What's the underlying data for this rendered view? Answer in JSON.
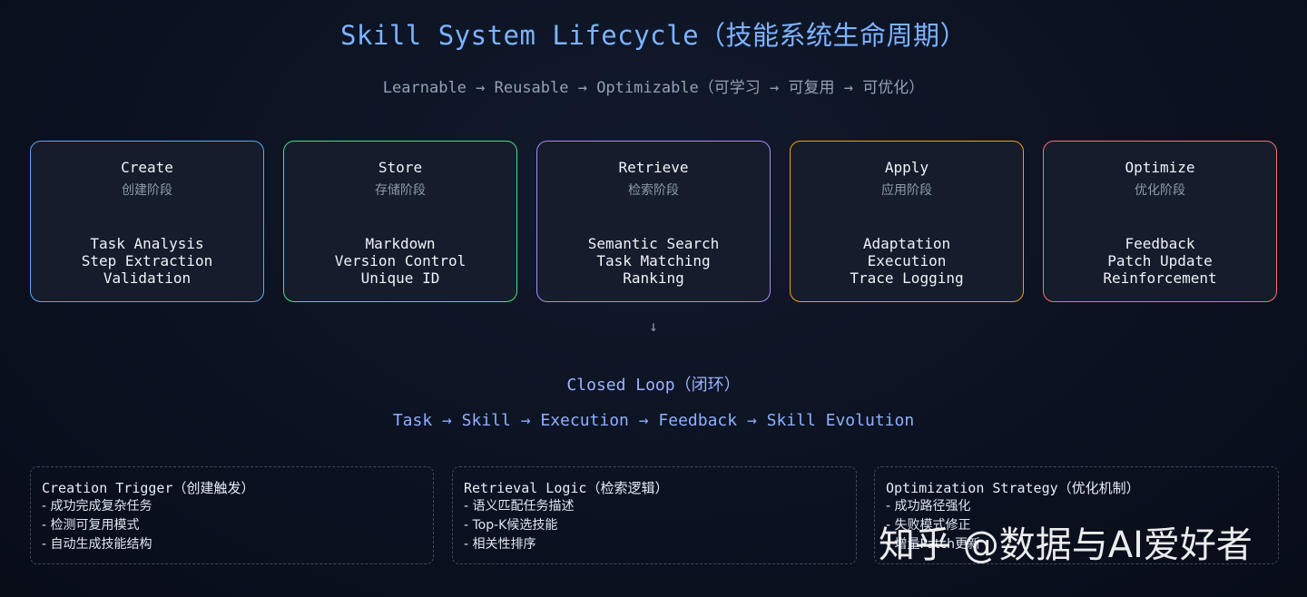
{
  "title": "Skill System Lifecycle（技能系统生命周期）",
  "subtitle": "Learnable → Reusable → Optimizable（可学习 → 可复用 → 可优化）",
  "stages": [
    {
      "name": "Create",
      "cn": "创建阶段",
      "steps": [
        "Task Analysis",
        "Step Extraction",
        "Validation"
      ],
      "color": "#60a5fa"
    },
    {
      "name": "Store",
      "cn": "存储阶段",
      "steps": [
        "Markdown",
        "Version Control",
        "Unique ID"
      ],
      "color": "#4ade80"
    },
    {
      "name": "Retrieve",
      "cn": "检索阶段",
      "steps": [
        "Semantic Search",
        "Task Matching",
        "Ranking"
      ],
      "color": "#a78bfa"
    },
    {
      "name": "Apply",
      "cn": "应用阶段",
      "steps": [
        "Adaptation",
        "Execution",
        "Trace Logging"
      ],
      "color": "#f59e0b"
    },
    {
      "name": "Optimize",
      "cn": "优化阶段",
      "steps": [
        "Feedback",
        "Patch Update",
        "Reinforcement"
      ],
      "color": "#f87171"
    }
  ],
  "arrow": "↓",
  "loop": {
    "title": "Closed Loop（闭环）",
    "flow": "Task → Skill → Execution → Feedback → Skill Evolution"
  },
  "notes": [
    {
      "title": "Creation Trigger（创建触发）",
      "items": [
        "- 成功完成复杂任务",
        "- 检测可复用模式",
        "- 自动生成技能结构"
      ]
    },
    {
      "title": "Retrieval Logic（检索逻辑）",
      "items": [
        "- 语义匹配任务描述",
        "- Top-K候选技能",
        "- 相关性排序"
      ]
    },
    {
      "title": "Optimization Strategy（优化机制）",
      "items": [
        "- 成功路径强化",
        "- 失败模式修正",
        "- 增量Patch更新"
      ]
    }
  ],
  "watermark": "知乎 @数据与AI爱好者"
}
